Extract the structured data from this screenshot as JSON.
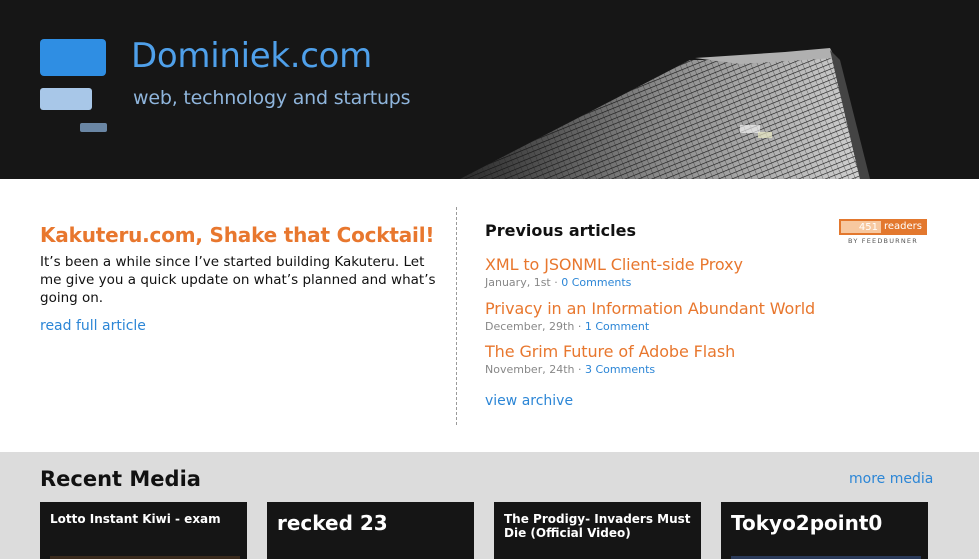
{
  "header": {
    "site_title": "Dominiek.com",
    "tagline": "web, technology and startups"
  },
  "featured": {
    "title": "Kakuteru.com, Shake that Cocktail!",
    "excerpt": "It’s been a while since I’ve started building Kakuteru. Let me give you a quick update on what’s planned and what’s going on.",
    "link_label": "read full article"
  },
  "previous": {
    "heading": "Previous articles",
    "articles": [
      {
        "title": "XML to JSONML Client-side Proxy",
        "date": "January, 1st",
        "comments": "0 Comments"
      },
      {
        "title": "Privacy in an Information Abundant World",
        "date": "December, 29th",
        "comments": "1 Comment"
      },
      {
        "title": "The Grim Future of Adobe Flash",
        "date": "November, 24th",
        "comments": "3 Comments"
      }
    ],
    "archive_label": "view archive",
    "separator": "·"
  },
  "feedburner": {
    "count": "451",
    "label": "readers",
    "sub": "BY FEEDBURNER"
  },
  "media": {
    "heading": "Recent Media",
    "more_label": "more media",
    "items": [
      {
        "title": "Lotto Instant Kiwi - exam"
      },
      {
        "title": "recked 23"
      },
      {
        "title": "The Prodigy- Invaders Must Die (Official Video)"
      },
      {
        "title": "Tokyo2point0"
      }
    ]
  },
  "colors": {
    "accent_orange": "#e8772e",
    "link_blue": "#2c86d6",
    "logo_blue": "#2f8ee3"
  }
}
